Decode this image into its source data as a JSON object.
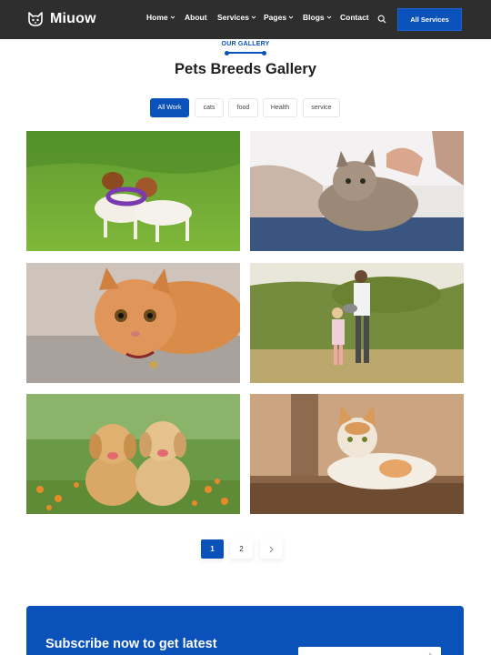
{
  "brand": {
    "name": "Miuow",
    "logo_icon": "cat-face-icon"
  },
  "nav": {
    "items": [
      {
        "label": "Home",
        "has_dropdown": true
      },
      {
        "label": "About",
        "has_dropdown": false
      },
      {
        "label": "Services",
        "has_dropdown": true
      },
      {
        "label": "Pages",
        "has_dropdown": true
      },
      {
        "label": "Blogs",
        "has_dropdown": true
      },
      {
        "label": "Contact",
        "has_dropdown": false
      }
    ],
    "search_icon": "search-icon",
    "cta_label": "All Services"
  },
  "section": {
    "eyebrow": "OUR GALLERY",
    "title": "Pets Breeds Gallery"
  },
  "filters": [
    {
      "label": "All Work",
      "active": true
    },
    {
      "label": "cats",
      "active": false
    },
    {
      "label": "food",
      "active": false
    },
    {
      "label": "Health",
      "active": false
    },
    {
      "label": "service",
      "active": false
    }
  ],
  "gallery": [
    {
      "subject": "two dogs playing tug with a purple ring toy on grass"
    },
    {
      "subject": "person petting a fluffy tabby cat"
    },
    {
      "subject": "orange kitten lying down looking up"
    },
    {
      "subject": "man and girl holding a cat in a garden"
    },
    {
      "subject": "two golden retriever puppies among orange flowers"
    },
    {
      "subject": "ginger and white cat lying on a wooden bench"
    }
  ],
  "pagination": {
    "pages": [
      "1",
      "2"
    ],
    "current": "1",
    "next_icon": "chevron-right-icon"
  },
  "subscribe": {
    "title": "Subscribe now to get latest",
    "submit_icon": "arrow-right-icon"
  },
  "colors": {
    "header_bg": "#2e2e2e",
    "accent": "#0a51b9",
    "heading": "#1e1e1e"
  }
}
